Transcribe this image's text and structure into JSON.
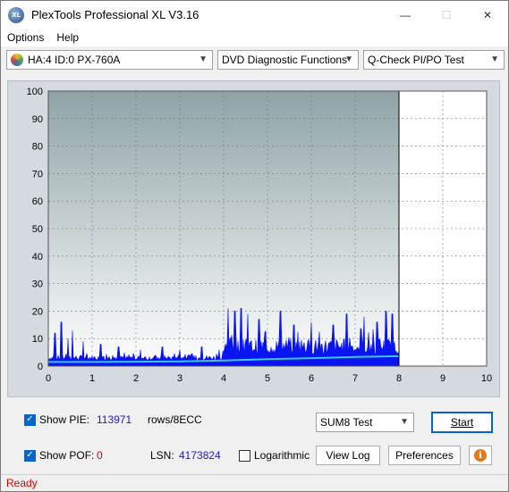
{
  "window": {
    "title": "PlexTools Professional XL V3.16",
    "icon_text": "XL",
    "minimize": "—",
    "maximize": "☐",
    "close": "✕"
  },
  "menu": {
    "options": "Options",
    "help": "Help"
  },
  "toolbar": {
    "drive": "HA:4 ID:0  PX-760A",
    "function": "DVD Diagnostic Functions",
    "test": "Q-Check PI/PO Test"
  },
  "colors": {
    "plot_bg_top": "#8fa3a6",
    "plot_bg_bottom": "#ffffff",
    "pie_bars": "#0a14f0",
    "sum_line": "#35c8e8",
    "accent": "#0a64c8",
    "status_text": "#d00000",
    "pof_value": "#d00000",
    "pie_value": "#1a1ad0"
  },
  "chart_data": {
    "type": "bar",
    "xlim": [
      0,
      10
    ],
    "ylim": [
      0,
      100
    ],
    "xticks": [
      "0",
      "1",
      "2",
      "3",
      "4",
      "5",
      "6",
      "7",
      "8",
      "9",
      "10"
    ],
    "yticks": [
      "0",
      "10",
      "20",
      "30",
      "40",
      "50",
      "60",
      "70",
      "80",
      "90",
      "100"
    ],
    "data_end_x": 8.0,
    "grid": true,
    "series": [
      {
        "kind": "bars",
        "segments": [
          {
            "x_start": 0.0,
            "x_end": 4.0,
            "base": 2,
            "typical": 4,
            "peaks": [
              [
                0.15,
                12
              ],
              [
                0.3,
                16
              ],
              [
                0.45,
                10
              ],
              [
                0.55,
                13
              ],
              [
                0.8,
                9
              ],
              [
                1.2,
                8
              ],
              [
                1.6,
                7
              ],
              [
                2.1,
                6
              ],
              [
                2.6,
                7
              ],
              [
                3.0,
                6
              ],
              [
                3.5,
                7
              ],
              [
                3.9,
                6
              ]
            ]
          },
          {
            "x_start": 4.0,
            "x_end": 8.0,
            "base": 4,
            "typical": 10,
            "peaks": [
              [
                4.1,
                21
              ],
              [
                4.25,
                20
              ],
              [
                4.4,
                21
              ],
              [
                4.55,
                19
              ],
              [
                4.8,
                17
              ],
              [
                5.3,
                20
              ],
              [
                5.6,
                15
              ],
              [
                6.0,
                16
              ],
              [
                6.5,
                15
              ],
              [
                6.8,
                19
              ],
              [
                7.2,
                18
              ],
              [
                7.5,
                16
              ],
              [
                7.7,
                20
              ],
              [
                7.85,
                19
              ]
            ]
          }
        ]
      },
      {
        "kind": "line",
        "x": [
          0,
          1,
          2,
          3,
          4,
          5,
          6,
          7,
          8
        ],
        "values": [
          1.5,
          1.5,
          1.6,
          1.7,
          2.0,
          2.5,
          2.9,
          3.3,
          3.6
        ]
      }
    ]
  },
  "controls": {
    "show_pie_label": "Show PIE:",
    "pie_value": "113971",
    "pie_unit": "rows/8ECC",
    "show_pof_label": "Show POF:",
    "pof_value": "0",
    "lsn_label": "LSN:",
    "lsn_value": "4173824",
    "logarithmic_label": "Logarithmic",
    "sum_select": "SUM8 Test",
    "start_button": "Start",
    "view_log_button": "View Log",
    "preferences_button": "Preferences",
    "info_icon": "i"
  },
  "status": {
    "text": "Ready"
  }
}
